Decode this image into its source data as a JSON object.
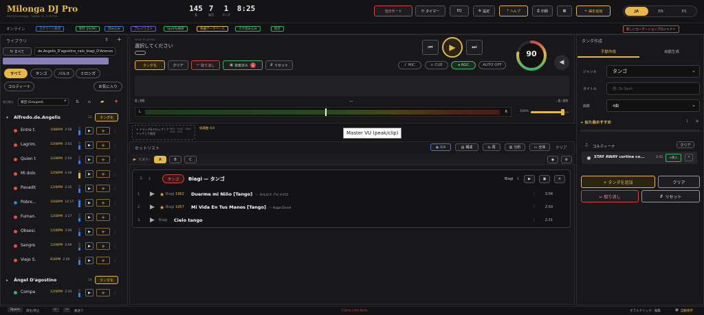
{
  "app": {
    "title": "Milonga DJ Pro",
    "subtitle": "PROFESSIONAL TANDA DJ SYSTEM"
  },
  "stats": [
    {
      "value": "145",
      "label": "曲"
    },
    {
      "value": "7",
      "label": "楽団"
    },
    {
      "value": "1",
      "label": "タンダ"
    },
    {
      "value": "8:25",
      "label": ""
    }
  ],
  "toolbar": {
    "practice": "当日モード",
    "timer": "タイマー",
    "eq": "EQ",
    "settings": "設定",
    "help": "ヘルプ",
    "print": "印刷",
    "more": "▦",
    "add_track": "曲を追加"
  },
  "languages": [
    "JA",
    "EN",
    "ES"
  ],
  "statusbar": {
    "online": "オンライン",
    "chips": [
      "スクリーン表示",
      "保存 (JSON)",
      "読み込み",
      "プレイリスト",
      "Spotify検索",
      "楽曲データベース",
      "タグ読み込み",
      "統計"
    ],
    "cortina_project": "新しいカーテーションプロジェクト"
  },
  "library": {
    "title": "ライブラリ",
    "all": "すべて",
    "search_value": "de.Angelis_D'agostino_calo_biagi_D'Arienzo",
    "filters": [
      "すべて",
      "タンゴ",
      "バルス",
      "ミロンガ",
      "コルティーナ",
      "お気に入り"
    ],
    "group_label": "並び替え",
    "group_value": "楽団 (Grouped)",
    "group1": {
      "name": "Alfredo.de.Angelis",
      "count": "12",
      "btn": "タンダ化"
    },
    "group2": {
      "name": "Ángel D'agostino",
      "count": "14",
      "btn": "タンダ化"
    },
    "tracks": [
      {
        "name": "Entre t...",
        "bpm": "108BPM",
        "dur": "2:58",
        "color": "#e0533d",
        "level": 0.6
      },
      {
        "name": "Lagrim...",
        "bpm": "120BPM",
        "dur": "3:03",
        "color": "#e0533d",
        "level": 0.5
      },
      {
        "name": "Quien t...",
        "bpm": "120BPM",
        "dur": "2:54",
        "color": "#e0533d",
        "level": 0.4
      },
      {
        "name": "Mi dolo...",
        "bpm": "120BPM",
        "dur": "2:48",
        "color": "#e0533d",
        "level": 0.7
      },
      {
        "name": "Pavadit...",
        "bpm": "120BPM",
        "dur": "2:45",
        "color": "#e0533d",
        "level": 0.5
      },
      {
        "name": "Pobre...",
        "bpm": "100BPM",
        "dur": "14:17",
        "color": "#3a7bd5",
        "level": 0.8
      },
      {
        "name": "Fuman...",
        "bpm": "120BPM",
        "dur": "3:27",
        "color": "#e0533d",
        "level": 0.4
      },
      {
        "name": "Obsesi...",
        "bpm": "120BPM",
        "dur": "3:00",
        "color": "#e0533d",
        "level": 0.5
      },
      {
        "name": "Sangre...",
        "bpm": "120BPM",
        "dur": "3:09",
        "color": "#e0533d",
        "level": 0.3
      },
      {
        "name": "Viejo S...",
        "bpm": "81BPM",
        "dur": "2:40",
        "color": "#e0533d",
        "level": 0.6
      }
    ],
    "track2": {
      "name": "Compa...",
      "bpm": "120BPM",
      "dur": "2:34",
      "color": "#3ab36a",
      "level": 0.5
    }
  },
  "player": {
    "now_playing_label": "NOW PLAYING",
    "now_playing": "選択してください",
    "tanda_btn": "タンダ化",
    "clear_btn": "クリア",
    "undo_btn": "取り消し",
    "played_btn": "演奏済み",
    "played_count": "0",
    "reset_btn": "リセット",
    "mic": "MIC",
    "cue": "CUE",
    "agc": "AGC",
    "auto_off": "AUTO OFF",
    "time_left": "0:00",
    "time_mid": "—",
    "time_right": "-0:00",
    "volume_pct": "100%",
    "volume_level": 0.82,
    "meter_value": "90",
    "meter_level": 0.78,
    "tooltip": "Master VU (peak/clip)"
  },
  "dropzone": {
    "text": "+ ドラッグ&ドロップ / クリックして追加",
    "formats": "MP3 · FLAC · WAV · M4A · AAC",
    "candidates": "候補曲 0/4"
  },
  "setlist": {
    "title": "セットリスト",
    "count_badge": "0/4",
    "btn_structure": "構成",
    "btn_play": "再",
    "btn_analyze": "分析",
    "btn_all": "全体",
    "btn_clear": "クリア",
    "list_label": "リスト:",
    "tabs": [
      "A",
      "B",
      "C"
    ],
    "tanda_tag": "タンゴ",
    "tanda_title": "Biagi — タンゴ",
    "tanda_artist": "Biagi",
    "tanda_index": "1",
    "tracks": [
      {
        "n": "1",
        "artist": "Biagi",
        "year": "1962",
        "star": true,
        "title": "Duerme mi Niño [Tango]",
        "sub": "— カルロス アルマグロ",
        "dur": "3:04"
      },
      {
        "n": "2",
        "artist": "Biagi",
        "year": "1957",
        "star": true,
        "title": "Mi Vida En Tus Manos [Tango]",
        "sub": "— Hugo Duval",
        "dur": "2:50"
      },
      {
        "n": "3",
        "artist": "Biagi",
        "year": "",
        "star": false,
        "title": "Cielo tango",
        "sub": "",
        "dur": "2:31"
      }
    ]
  },
  "tanda_builder": {
    "title": "タンダ作成",
    "tab_manual": "手動作成",
    "tab_auto": "自動生成",
    "genre_label": "ジャンル",
    "genre_value": "タンゴ",
    "title_label": "タイトル",
    "title_placeholder": "例: Di Sarli",
    "count_label": "曲数",
    "count_value": "4曲",
    "recommend": "似た曲おすすめ",
    "cortina_label": "コルティーナ",
    "cortina_clear": "クリア",
    "cortina_track": "STAY AWAY cortina co...",
    "cortina_dur": "2:55",
    "cortina_insert": "+挿入",
    "add_tanda": "+ タンダを追加",
    "clear": "クリア",
    "undo": "↩ 取り消し",
    "reset": "リセット"
  },
  "footer": {
    "space": "Space",
    "play_stop": "再生/停止",
    "nav": "曲送り",
    "stats": "T:100% V:0% M:0%",
    "dblclick": "ダブルクリック：編集",
    "autosave": "自動保存"
  }
}
